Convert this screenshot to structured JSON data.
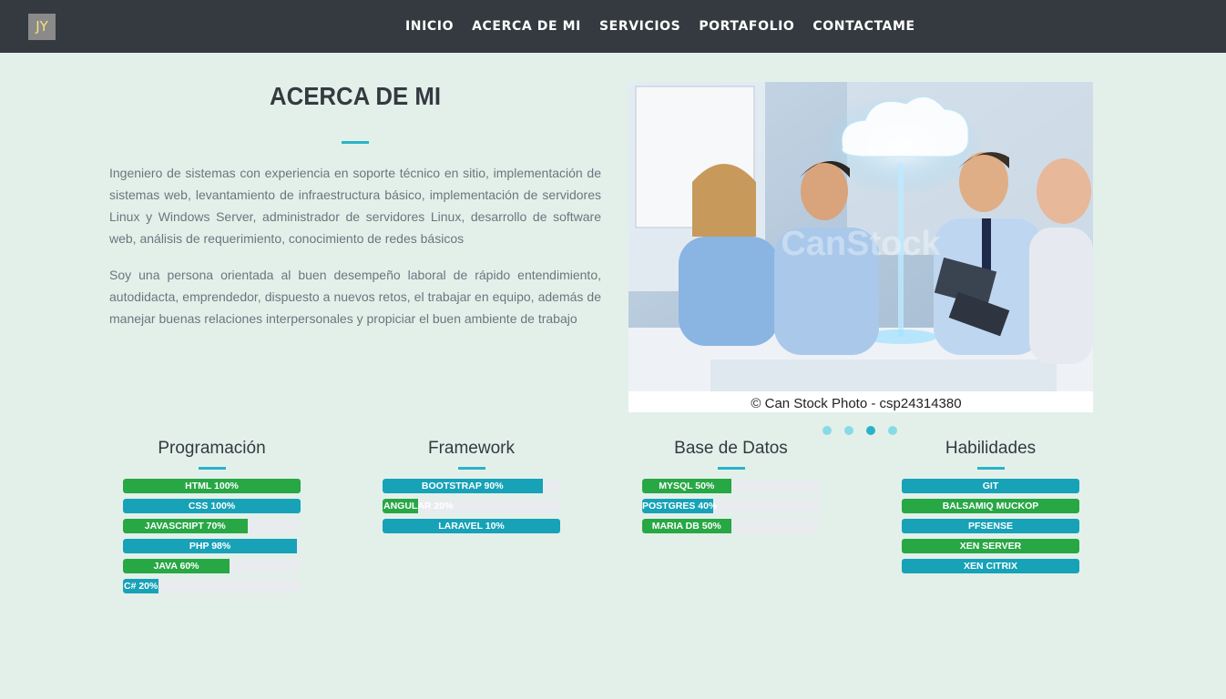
{
  "logo": {
    "text": "JY"
  },
  "nav": [
    "INICIO",
    "ACERCA DE MI",
    "SERVICIOS",
    "PORTAFOLIO",
    "CONTACTAME"
  ],
  "about": {
    "title": "ACERCA DE MI",
    "paragraph1": "Ingeniero de sistemas con experiencia en soporte técnico en sitio, implementación de sistemas web, levantamiento de infraestructura básico, implementación de servidores Linux y Windows Server, administrador de servidores Linux, desarrollo de software web, análisis de requerimiento, conocimiento de redes básicos",
    "paragraph2": "Soy una persona orientada al buen desempeño laboral de rápido entendimiento, autodidacta, emprendedor, dispuesto a nuevos retos, el trabajar en equipo, además de manejar buenas relaciones interpersonales y propiciar el buen ambiente de trabajo"
  },
  "carousel": {
    "watermark": "CanStock",
    "caption": "© Can Stock Photo - csp24314380",
    "slide_count": 4,
    "active_index": 2
  },
  "skills": {
    "programacion": {
      "title": "Programación",
      "items": [
        {
          "label": "HTML 100%",
          "percent": 100,
          "color": "green"
        },
        {
          "label": "CSS 100%",
          "percent": 100,
          "color": "teal"
        },
        {
          "label": "JAVASCRIPT 70%",
          "percent": 70,
          "color": "green"
        },
        {
          "label": "PHP 98%",
          "percent": 98,
          "color": "teal"
        },
        {
          "label": "JAVA 60%",
          "percent": 60,
          "color": "green"
        },
        {
          "label": "C# 20%",
          "percent": 20,
          "color": "teal"
        }
      ]
    },
    "framework": {
      "title": "Framework",
      "items": [
        {
          "label": "BOOTSTRAP 90%",
          "percent": 90,
          "color": "teal"
        },
        {
          "label": "ANGULAR 20%",
          "percent": 20,
          "color": "green"
        },
        {
          "label": "LARAVEL 10%",
          "percent": 100,
          "color": "teal"
        }
      ]
    },
    "base_datos": {
      "title": "Base de Datos",
      "items": [
        {
          "label": "MYSQL 50%",
          "percent": 50,
          "color": "green"
        },
        {
          "label": "POSTGRES 40%",
          "percent": 40,
          "color": "teal"
        },
        {
          "label": "MARIA DB 50%",
          "percent": 50,
          "color": "green"
        }
      ]
    },
    "habilidades": {
      "title": "Habilidades",
      "items": [
        {
          "label": "GIT",
          "color": "teal"
        },
        {
          "label": "BALSAMIQ MUCKOP",
          "color": "green"
        },
        {
          "label": "PFSENSE",
          "color": "teal"
        },
        {
          "label": "XEN SERVER",
          "color": "green"
        },
        {
          "label": "XEN CITRIX",
          "color": "teal"
        }
      ]
    }
  },
  "colors": {
    "navbar": "#343a40",
    "accent": "#29b3c9",
    "green": "#28a745",
    "teal": "#17a2b8",
    "background": "#e3f0ea"
  }
}
